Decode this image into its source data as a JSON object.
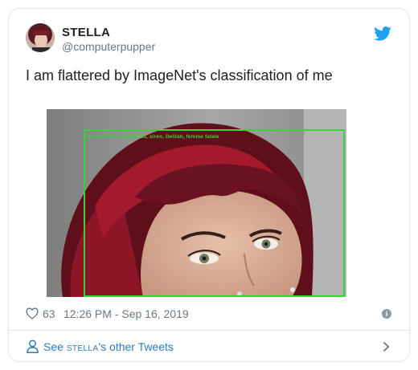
{
  "author": {
    "display_name": "STELLA",
    "handle": "@computerpupper"
  },
  "tweet": {
    "text": "I am flattered by ImageNet's classification of me",
    "media": {
      "detection_label": "enchantress, temptress, siren, Delilah, femme fatale",
      "box_color": "#39d23a"
    }
  },
  "meta": {
    "likes": "63",
    "timestamp": "12:26 PM - Sep 16, 2019",
    "info_glyph": "i"
  },
  "footer": {
    "prefix": "See",
    "name": "stella",
    "suffix": "'s other Tweets"
  },
  "icons": {
    "brand": "twitter-bird-icon",
    "like": "heart-icon",
    "info": "info-icon",
    "profile": "person-icon",
    "nav": "chevron-right-icon"
  },
  "colors": {
    "brand_blue": "#1da1f2",
    "link_blue": "#2b7bb9",
    "muted": "#697882",
    "border": "#e1e8ed"
  }
}
